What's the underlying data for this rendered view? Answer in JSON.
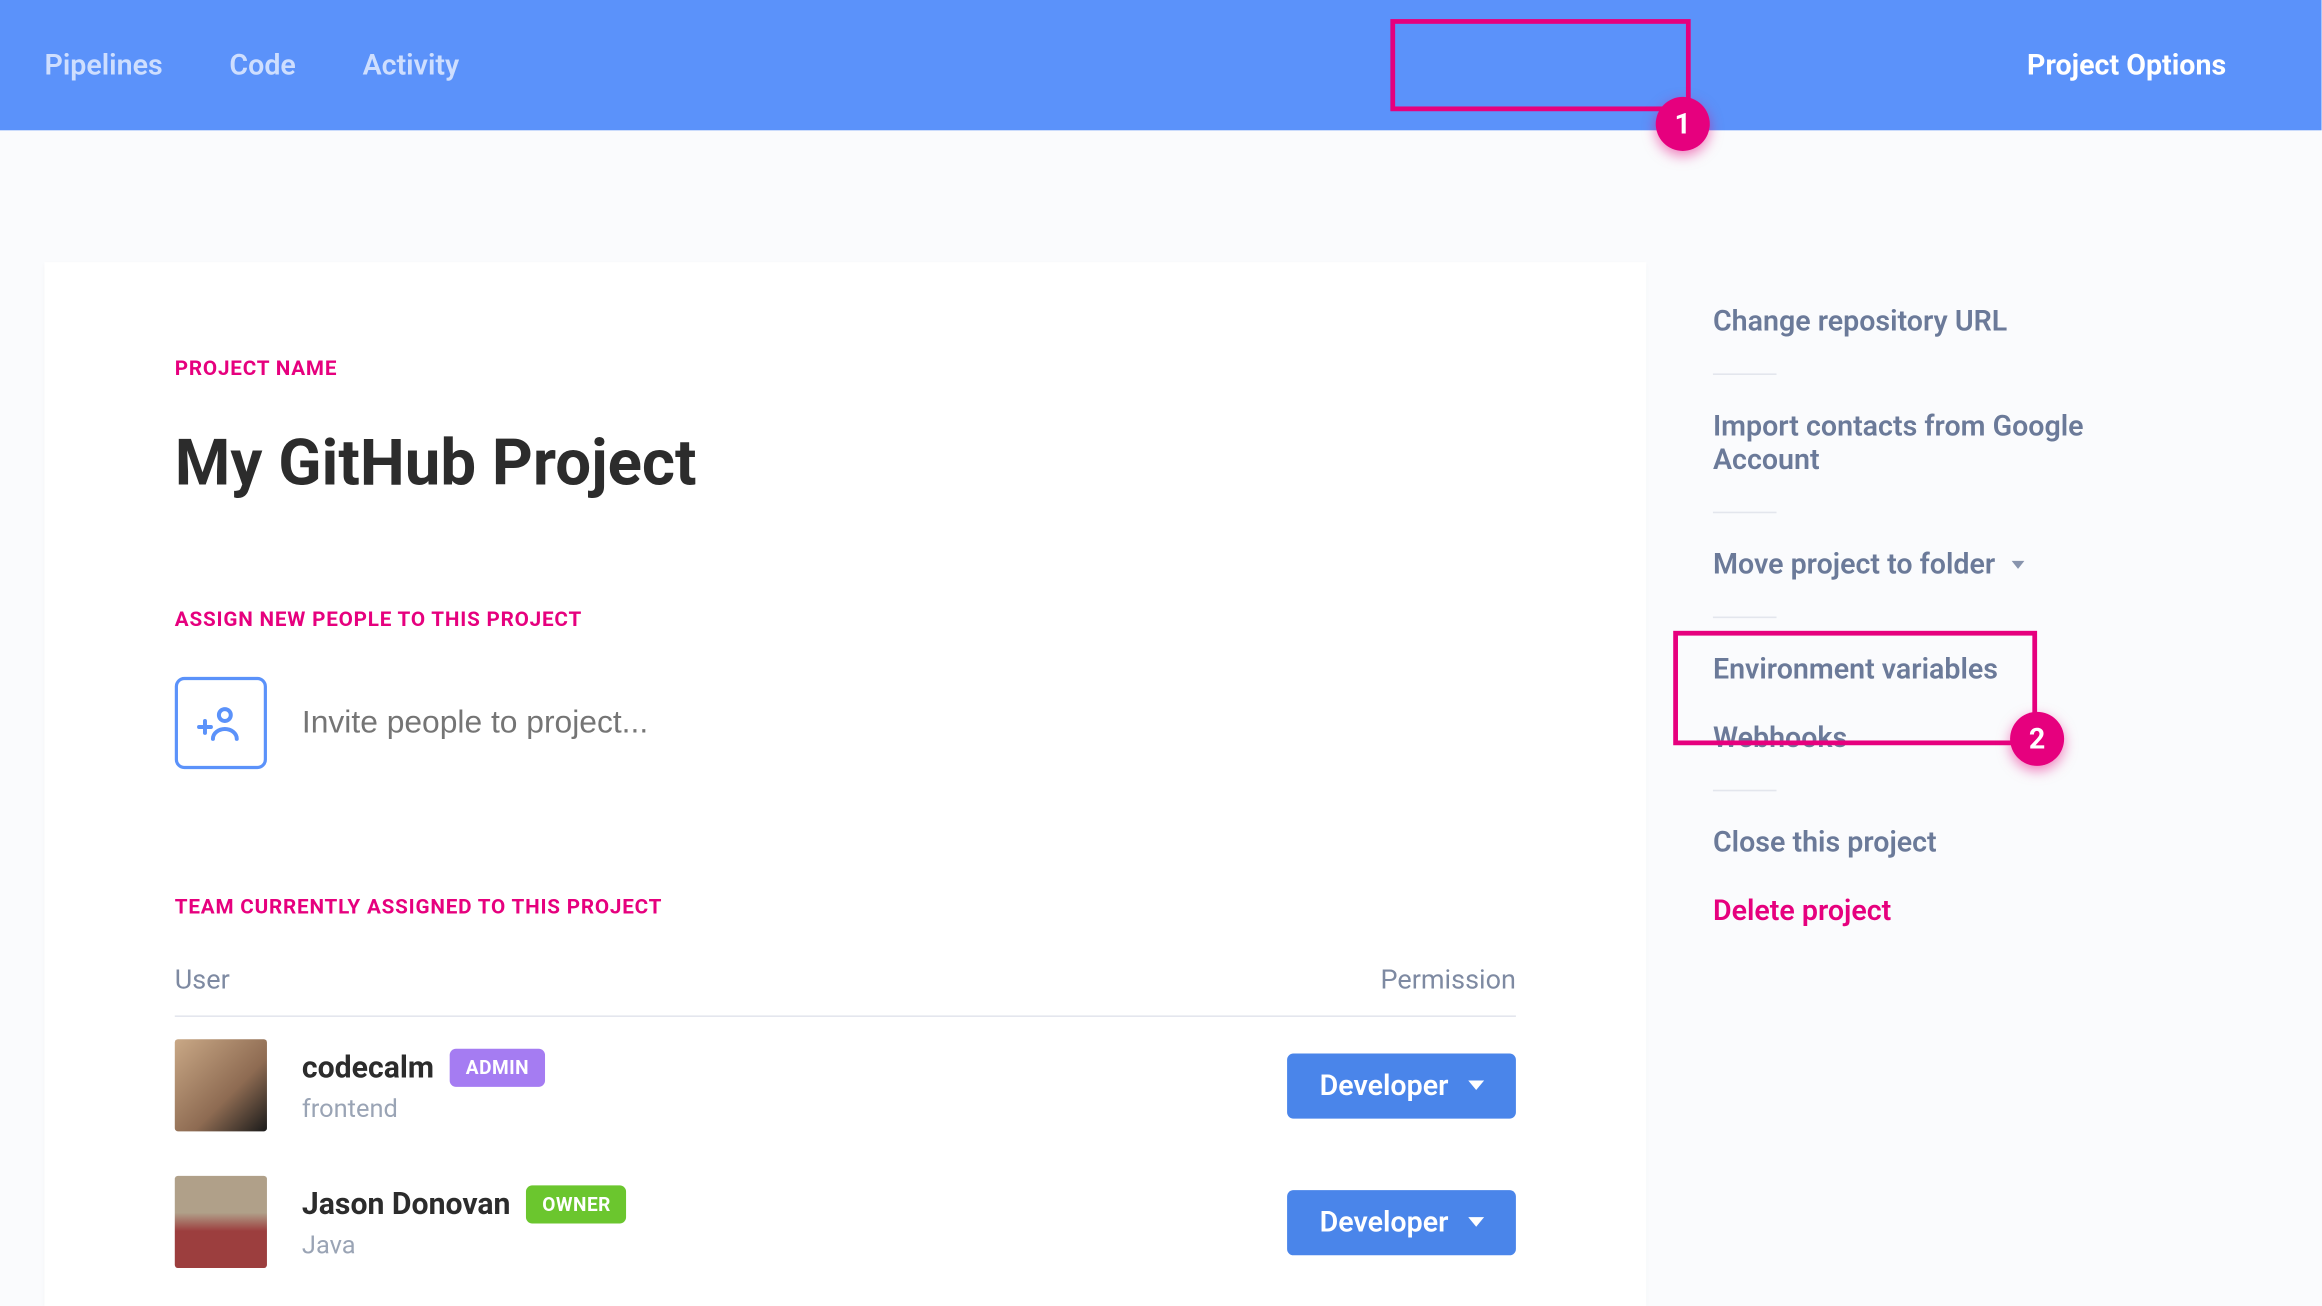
{
  "nav": {
    "pipelines": "Pipelines",
    "code": "Code",
    "activity": "Activity",
    "project_options": "Project Options"
  },
  "callouts": {
    "one": "1",
    "two": "2"
  },
  "sections": {
    "project_name_label": "PROJECT NAME",
    "project_name": "My GitHub Project",
    "assign_label": "ASSIGN NEW PEOPLE TO THIS PROJECT",
    "invite_placeholder": "Invite people to project...",
    "team_label": "TEAM CURRENTLY ASSIGNED TO THIS PROJECT"
  },
  "table": {
    "col_user": "User",
    "col_permission": "Permission"
  },
  "team": [
    {
      "name": "codecalm",
      "badge": "ADMIN",
      "badge_class": "admin",
      "sub": "frontend",
      "perm": "Developer"
    },
    {
      "name": "Jason Donovan",
      "badge": "OWNER",
      "badge_class": "owner",
      "sub": "Java",
      "perm": "Developer"
    }
  ],
  "sidebar": {
    "change_repo": "Change repository URL",
    "import_contacts": "Import contacts from Google Account",
    "move_project": "Move project to folder",
    "env_vars": "Environment variables",
    "webhooks": "Webhooks",
    "close_project": "Close this project",
    "delete_project": "Delete project"
  }
}
